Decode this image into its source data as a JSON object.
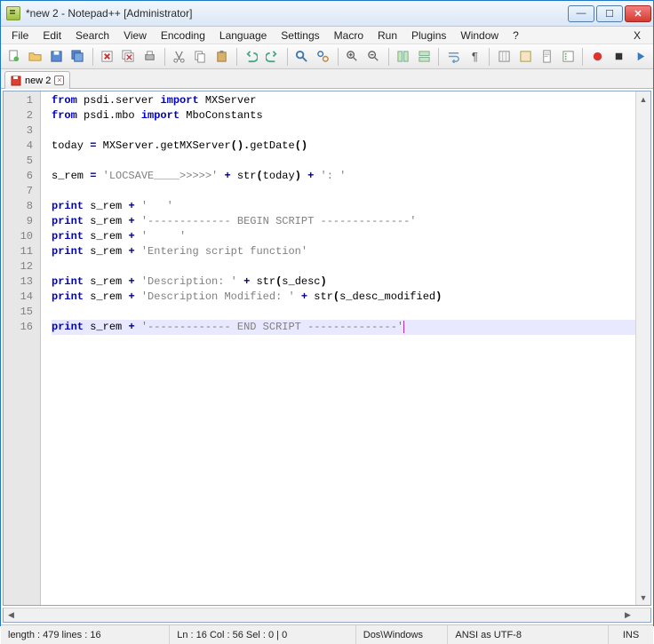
{
  "title": "*new  2 - Notepad++ [Administrator]",
  "menu": [
    "File",
    "Edit",
    "Search",
    "View",
    "Encoding",
    "Language",
    "Settings",
    "Macro",
    "Run",
    "Plugins",
    "Window",
    "?"
  ],
  "menu_close": "X",
  "tab": {
    "label": "new  2"
  },
  "gutter": [
    "1",
    "2",
    "3",
    "4",
    "5",
    "6",
    "7",
    "8",
    "9",
    "10",
    "11",
    "12",
    "13",
    "14",
    "15",
    "16"
  ],
  "code": {
    "l1": {
      "a": "from",
      "b": " psdi.server ",
      "c": "import",
      "d": " MXServer"
    },
    "l2": {
      "a": "from",
      "b": " psdi.mbo ",
      "c": "import",
      "d": " MboConstants"
    },
    "l4": {
      "a": "today ",
      "b": "=",
      "c": " MXServer.getMXServer",
      "d": "().",
      "e": "getDate",
      "f": "()"
    },
    "l6": {
      "a": "s_rem ",
      "b": "=",
      "c": " ",
      "d": "'LOCSAVE____>>>>>'",
      "e": " ",
      "f": "+",
      "g": " str",
      "h": "(",
      "i": "today",
      "j": ")",
      "k": " ",
      "l": "+",
      "m": " ",
      "n": "': '"
    },
    "l8": {
      "a": "print",
      "b": " s_rem ",
      "c": "+",
      "d": " ",
      "e": "'   '"
    },
    "l9": {
      "a": "print",
      "b": " s_rem ",
      "c": "+",
      "d": " ",
      "e": "'------------- BEGIN SCRIPT --------------'"
    },
    "l10": {
      "a": "print",
      "b": " s_rem ",
      "c": "+",
      "d": " ",
      "e": "'     '"
    },
    "l11": {
      "a": "print",
      "b": " s_rem ",
      "c": "+",
      "d": " ",
      "e": "'Entering script function'"
    },
    "l13": {
      "a": "print",
      "b": " s_rem ",
      "c": "+",
      "d": " ",
      "e": "'Description: '",
      "f": " ",
      "g": "+",
      "h": " str",
      "i": "(",
      "j": "s_desc",
      "k": ")"
    },
    "l14": {
      "a": "print",
      "b": " s_rem ",
      "c": "+",
      "d": " ",
      "e": "'Description Modified: '",
      "f": " ",
      "g": "+",
      "h": " str",
      "i": "(",
      "j": "s_desc_modified",
      "k": ")"
    },
    "l16": {
      "a": "print",
      "b": " s_rem ",
      "c": "+",
      "d": " ",
      "e": "'------------- END SCRIPT --------------'"
    }
  },
  "status": {
    "length": "length : 479    lines : 16",
    "pos": "Ln : 16    Col : 56    Sel : 0 | 0",
    "eol": "Dos\\Windows",
    "enc": "ANSI as UTF-8",
    "ins": "INS"
  }
}
